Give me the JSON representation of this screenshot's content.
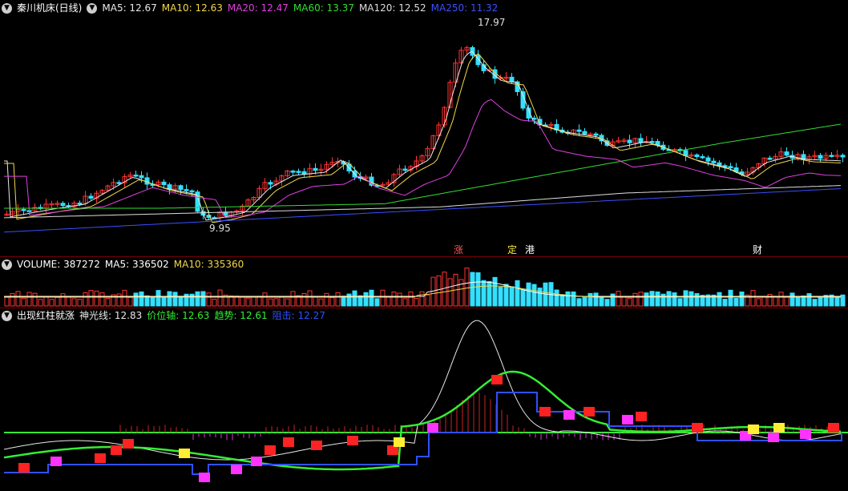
{
  "main": {
    "title": "秦川机床(日线)",
    "ma": [
      {
        "label": "MA5: 12.67",
        "color": "#e8e8e8"
      },
      {
        "label": "MA10: 12.63",
        "color": "#f2d84a"
      },
      {
        "label": "MA20: 12.47",
        "color": "#e040e0"
      },
      {
        "label": "MA60: 13.37",
        "color": "#33dd33"
      },
      {
        "label": "MA120: 12.52",
        "color": "#dddddd"
      },
      {
        "label": "MA250: 11.32",
        "color": "#3a50ff"
      }
    ],
    "high_label": "17.97",
    "low_label": "9.95",
    "events": [
      {
        "text": "涨",
        "color": "#ff5555"
      },
      {
        "text": "定",
        "color": "#ffee44"
      },
      {
        "text": "港",
        "color": "#ffffff"
      },
      {
        "text": "财",
        "color": "#ffffff"
      }
    ]
  },
  "volume": {
    "title": "VOLUME: 387272",
    "ma5": "MA5: 336502",
    "ma10": "MA10: 335360"
  },
  "indicator": {
    "title": "出现红柱就涨",
    "lines": [
      {
        "label": "神光线: 12.83",
        "color": "#e8e8e8"
      },
      {
        "label": "价位轴: 12.63",
        "color": "#33ee33"
      },
      {
        "label": "趋势: 12.61",
        "color": "#33ee33"
      },
      {
        "label": "阻击: 12.27",
        "color": "#3050ff"
      }
    ]
  },
  "colors": {
    "up": "#ff3333",
    "down": "#33e0ff",
    "background": "#000000",
    "grid": "#7a0000"
  }
}
